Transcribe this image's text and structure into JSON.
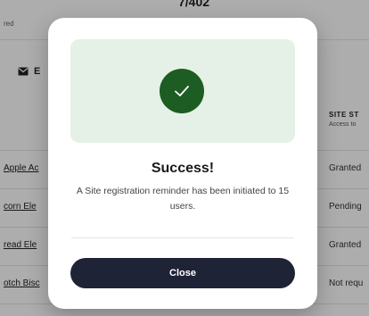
{
  "background": {
    "top_left_text": "red",
    "top_counter": "7/402",
    "email_button_label": "E",
    "table": {
      "status_header": "SITE ST",
      "status_subheader": "Access to",
      "rows": [
        {
          "name": "Apple Ac",
          "status": "Granted"
        },
        {
          "name": "corn Ele",
          "status": "Pending"
        },
        {
          "name": "read Ele",
          "status": "Granted"
        },
        {
          "name": "otch Bisc",
          "status": "Not requ"
        }
      ]
    }
  },
  "modal": {
    "title": "Success!",
    "message": "A Site registration reminder has been initiated to 15 users.",
    "close_label": "Close",
    "accent_color": "#1d5c22",
    "panel_color": "#e5f1e6",
    "button_color": "#1f2336"
  }
}
